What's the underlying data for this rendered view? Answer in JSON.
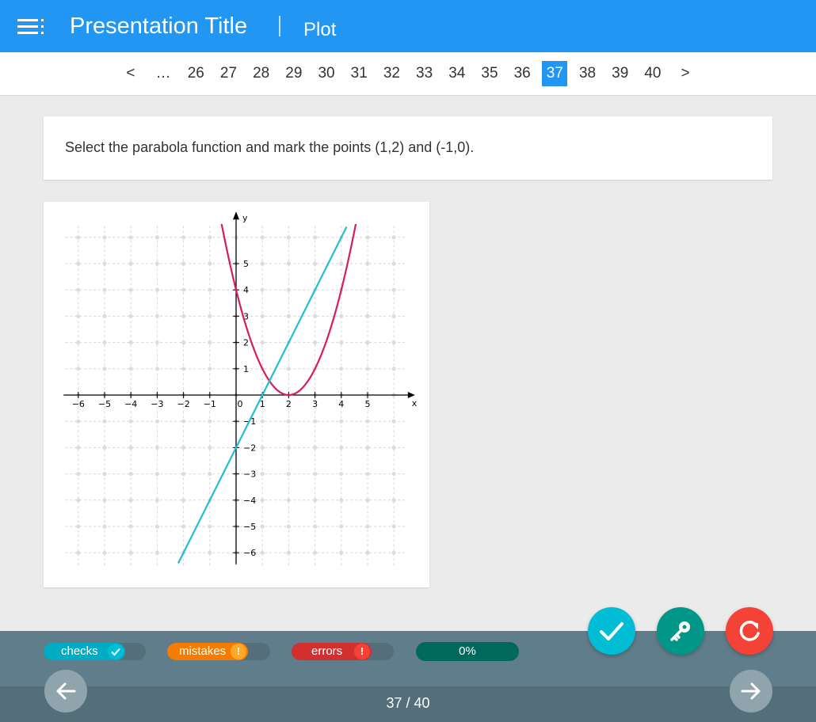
{
  "header": {
    "title": "Presentation Title",
    "subtitle": "Plot",
    "color": "#2196f3"
  },
  "pagination": {
    "prev": "<",
    "ellipsis": "…",
    "pages": [
      "26",
      "27",
      "28",
      "29",
      "30",
      "31",
      "32",
      "33",
      "34",
      "35",
      "36",
      "37",
      "38",
      "39",
      "40"
    ],
    "active": "37",
    "next": ">"
  },
  "question": {
    "text": "Select the parabola function and mark the points (1,2) and (-1,0)."
  },
  "chart_data": {
    "type": "line",
    "xlabel": "x",
    "ylabel": "y",
    "xlim": [
      -6.5,
      6.5
    ],
    "ylim": [
      -6.5,
      6.5
    ],
    "grid": true,
    "x_ticks": [
      "−6",
      "−5",
      "−4",
      "−3",
      "−2",
      "−1",
      "0",
      "1",
      "2",
      "3",
      "4",
      "5"
    ],
    "y_ticks": [
      "−6",
      "−5",
      "−4",
      "−3",
      "−2",
      "−1",
      "1",
      "2",
      "3",
      "4",
      "5"
    ],
    "series": [
      {
        "color": "#d81b60",
        "function": "(x-2)^2",
        "x": [
          -0.5,
          0,
          1,
          2,
          3,
          4,
          4.5
        ],
        "y": [
          6.25,
          4,
          1,
          0,
          1,
          4,
          6.25
        ]
      },
      {
        "color": "#26bcd0",
        "function": "2x-2",
        "x": [
          -2.2,
          0,
          1,
          2,
          3,
          4.2
        ],
        "y": [
          -6.4,
          -2,
          0,
          2,
          4,
          6.4
        ]
      }
    ]
  },
  "footer": {
    "checks_label": "checks",
    "checks_icon": "check-icon",
    "mistakes_label": "mistakes",
    "mistakes_badge": "!",
    "errors_label": "errors",
    "errors_badge": "!",
    "progress": "0%",
    "page_counter": "37 / 40",
    "colors": {
      "checks": "#00acc1",
      "mistakes": "#f57c00",
      "errors": "#d32f2f",
      "progress": "#00695c",
      "check_fab": "#00bcd4",
      "key_fab": "#009688",
      "reset_fab": "#f44336"
    }
  }
}
